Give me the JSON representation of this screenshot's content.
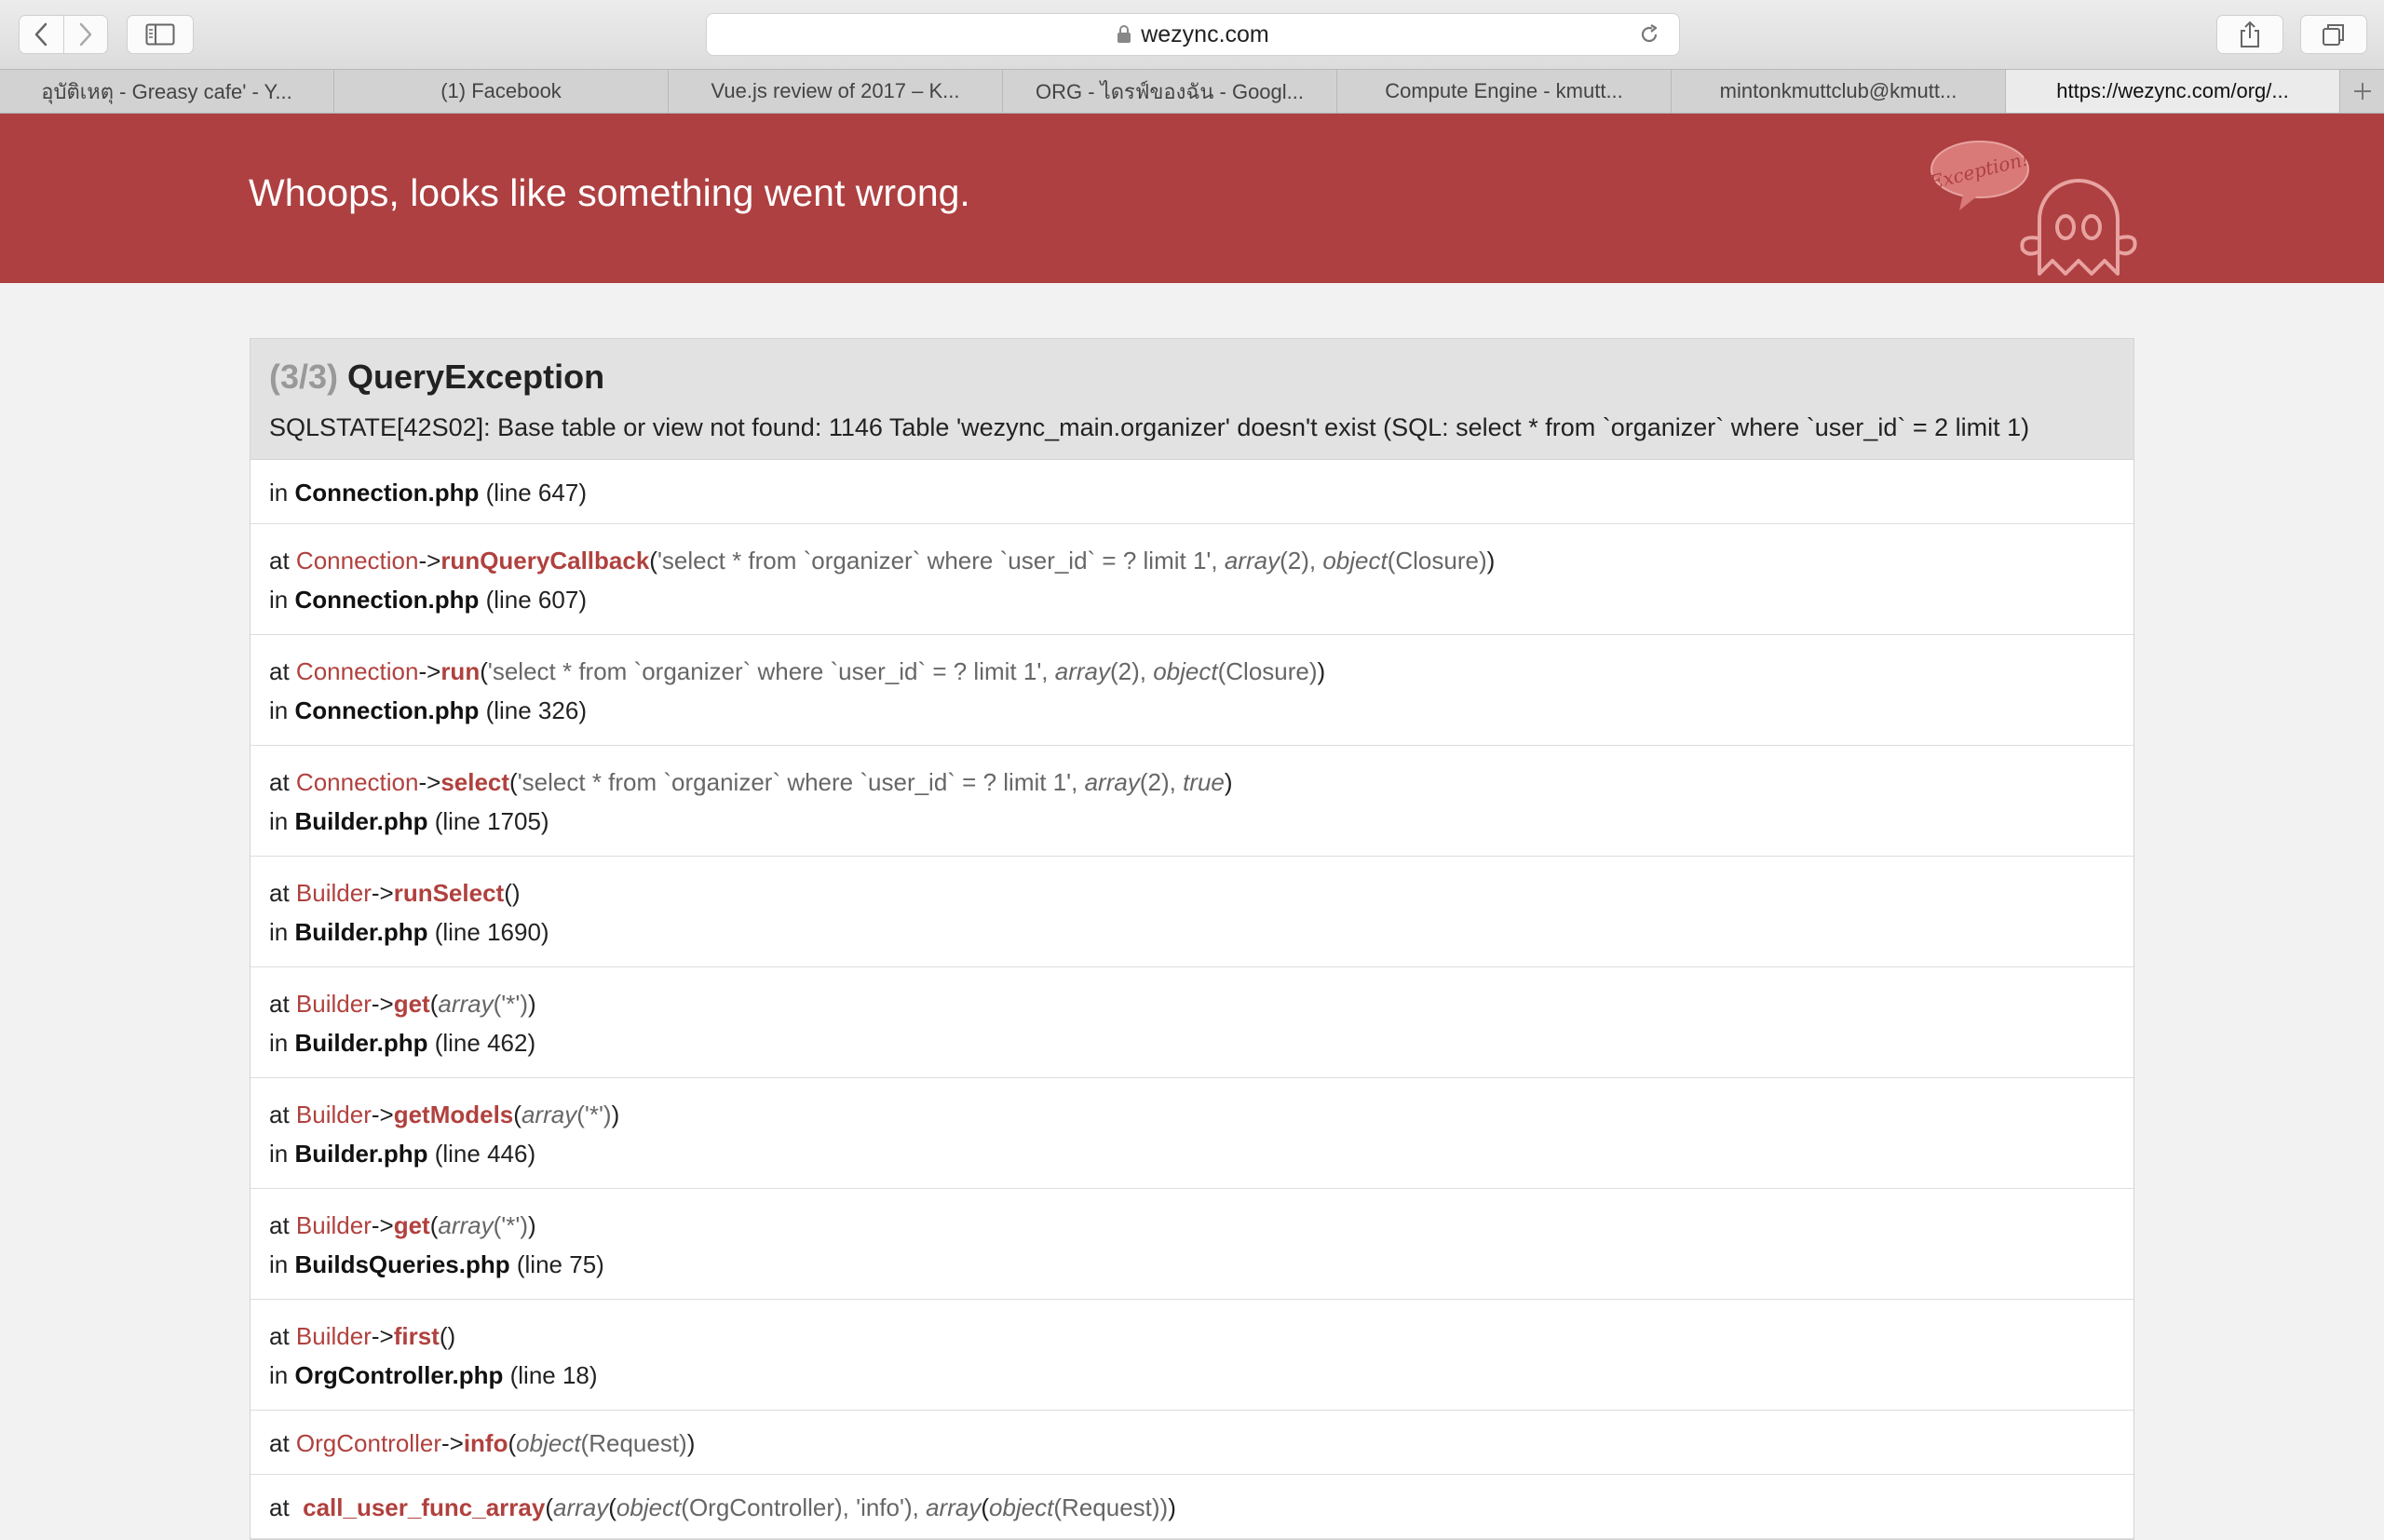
{
  "browser": {
    "url": "wezync.com",
    "tabs": [
      "อุบัติเหตุ - Greasy cafe' - Y...",
      "(1) Facebook",
      "Vue.js review of 2017 – K...",
      "ORG - ไดรฟ์ของฉัน - Googl...",
      "Compute Engine - kmutt...",
      "mintonkmuttclub@kmutt...",
      "https://wezync.com/org/..."
    ]
  },
  "header": {
    "title": "Whoops, looks like something went wrong.",
    "badge": "Exception!"
  },
  "exception": {
    "count": "(3/3)",
    "name": "QueryException",
    "message": "SQLSTATE[42S02]: Base table or view not found: 1146 Table 'wezync_main.organizer' doesn't exist (SQL: select * from `organizer` where `user_id` = 2 limit 1)",
    "first_file": "Connection.php",
    "first_line": "(line 647)"
  },
  "frames": [
    {
      "class": "Connection",
      "method": "runQueryCallback",
      "args": [
        "'select * from `organizer` where `user_id` = ? limit 1', ",
        "array",
        "(2), ",
        "object",
        "(Closure)"
      ],
      "file": "Connection.php",
      "line": "(line 607)"
    },
    {
      "class": "Connection",
      "method": "run",
      "args": [
        "'select * from `organizer` where `user_id` = ? limit 1', ",
        "array",
        "(2), ",
        "object",
        "(Closure)"
      ],
      "file": "Connection.php",
      "line": "(line 326)"
    },
    {
      "class": "Connection",
      "method": "select",
      "args": [
        "'select * from `organizer` where `user_id` = ? limit 1', ",
        "array",
        "(2), ",
        "true",
        ""
      ],
      "file": "Builder.php",
      "line": "(line 1705)"
    },
    {
      "class": "Builder",
      "method": "runSelect",
      "args": [
        "",
        "",
        "",
        "",
        ""
      ],
      "file": "Builder.php",
      "line": "(line 1690)"
    },
    {
      "class": "Builder",
      "method": "get",
      "args": [
        "",
        "array",
        "('*')",
        "",
        ""
      ],
      "file": "Builder.php",
      "line": "(line 462)"
    },
    {
      "class": "Builder",
      "method": "getModels",
      "args": [
        "",
        "array",
        "('*')",
        "",
        ""
      ],
      "file": "Builder.php",
      "line": "(line 446)"
    },
    {
      "class": "Builder",
      "method": "get",
      "args": [
        "",
        "array",
        "('*')",
        "",
        ""
      ],
      "file": "BuildsQueries.php",
      "line": "(line 75)"
    },
    {
      "class": "Builder",
      "method": "first",
      "args": [
        "",
        "",
        "",
        "",
        ""
      ],
      "file": "OrgController.php",
      "line": "(line 18)"
    },
    {
      "class": "OrgController",
      "method": "info",
      "args": [
        "",
        "object",
        "(Request)",
        "",
        ""
      ],
      "file": "",
      "line": ""
    }
  ],
  "last_frame": {
    "method": "call_user_func_array",
    "kw1": "array",
    "kw2": "object",
    "t1": "(OrgController), 'info'), ",
    "kw3": "array",
    "kw4": "object",
    "t2": "(Request))"
  },
  "labels": {
    "at": "at",
    "in": "in",
    "arrow": "->"
  }
}
